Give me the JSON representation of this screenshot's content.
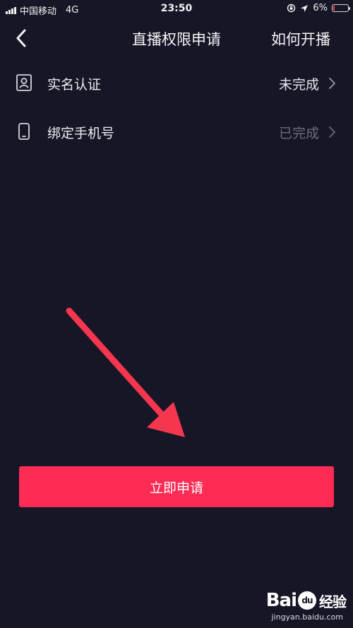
{
  "status_bar": {
    "carrier": "中国移动",
    "network": "4G",
    "time": "23:50",
    "battery": "6%",
    "battery_level": 0.06
  },
  "nav": {
    "title": "直播权限申请",
    "action": "如何开播"
  },
  "list": [
    {
      "label": "实名认证",
      "status": "未完成",
      "status_color": "#e6e6ec",
      "icon": "person-card-icon"
    },
    {
      "label": "绑定手机号",
      "status": "已完成",
      "status_color": "#6d6c7c",
      "icon": "phone-icon"
    }
  ],
  "apply_button": {
    "label": "立即申请"
  },
  "watermark": {
    "logo": "Bai 经验",
    "url": "jingyan.baidu.com"
  },
  "colors": {
    "background": "#171626",
    "accent": "#fe2c55",
    "arrow": "#f4364f"
  }
}
